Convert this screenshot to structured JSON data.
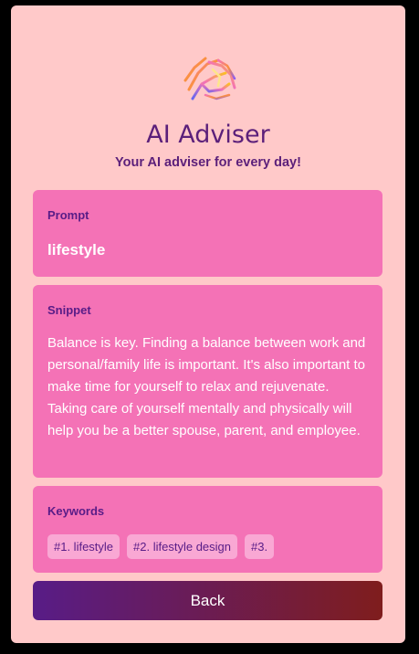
{
  "app": {
    "title": "AI Adviser",
    "subtitle": "Your AI adviser for every day!",
    "logo_icon": "hand-logo-icon"
  },
  "prompt": {
    "label": "Prompt",
    "value": "lifestyle"
  },
  "snippet": {
    "label": "Snippet",
    "text": "Balance is key. Finding a balance between work and personal/family life is important. It's also important to make time for yourself to relax and rejuvenate. Taking care of yourself mentally and physically will help you be a better spouse, parent, and employee."
  },
  "keywords": {
    "label": "Keywords",
    "items": [
      "#1. lifestyle",
      "#2. lifestyle design",
      "#3."
    ]
  },
  "back_button": {
    "label": "Back"
  },
  "colors": {
    "background": "#ffc9c9",
    "panel": "#f472b6",
    "keyword_chip": "#f9a8d4",
    "heading_text": "#581c87",
    "button_gradient_start": "#581c87",
    "button_gradient_end": "#7f1d1d"
  }
}
